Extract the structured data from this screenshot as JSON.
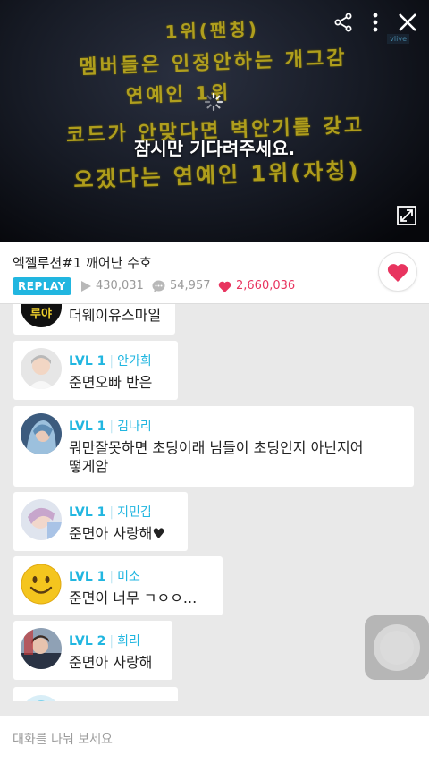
{
  "video": {
    "sign_lines": [
      "1위(팬칭)",
      "멤버들은 인정안하는 개그감",
      "연예인 1위",
      "코드가 안맞다면 벽안기를 갖고",
      "오겠다는 연예인 1위(자칭)"
    ],
    "loading_text": "잠시만 기다려주세요.",
    "icons": [
      "share-icon",
      "more-icon",
      "close-icon",
      "expand-icon"
    ]
  },
  "info": {
    "title": "엑젤루션#1 깨어난 수호",
    "badge": "REPLAY",
    "plays": "430,031",
    "comments": "54,957",
    "likes": "2,660,036"
  },
  "chat": {
    "messages": [
      {
        "badge": "루야",
        "text": "더웨이유스마일"
      },
      {
        "level": "LVL 1",
        "nick": "안가희",
        "text": "준면오빠 반은"
      },
      {
        "level": "LVL 1",
        "nick": "김나리",
        "text": "뭐만잘못하면 초딩이래 님들이 초딩인지 아닌지어",
        "text2": "떻게암"
      },
      {
        "level": "LVL 1",
        "nick": "지민김",
        "text": "준면아 사랑해♥"
      },
      {
        "level": "LVL 1",
        "nick": "미소",
        "text": "준면이 너무 ㄱㅇㅇ..."
      },
      {
        "level": "LVL 2",
        "nick": "희리",
        "text": "준면아 사랑해"
      }
    ]
  },
  "input": {
    "placeholder": "대화를 나눠 보세요"
  },
  "colors": {
    "accent": "#21b6e0",
    "like": "#e8345f",
    "sign_text": "#c9b41a"
  }
}
